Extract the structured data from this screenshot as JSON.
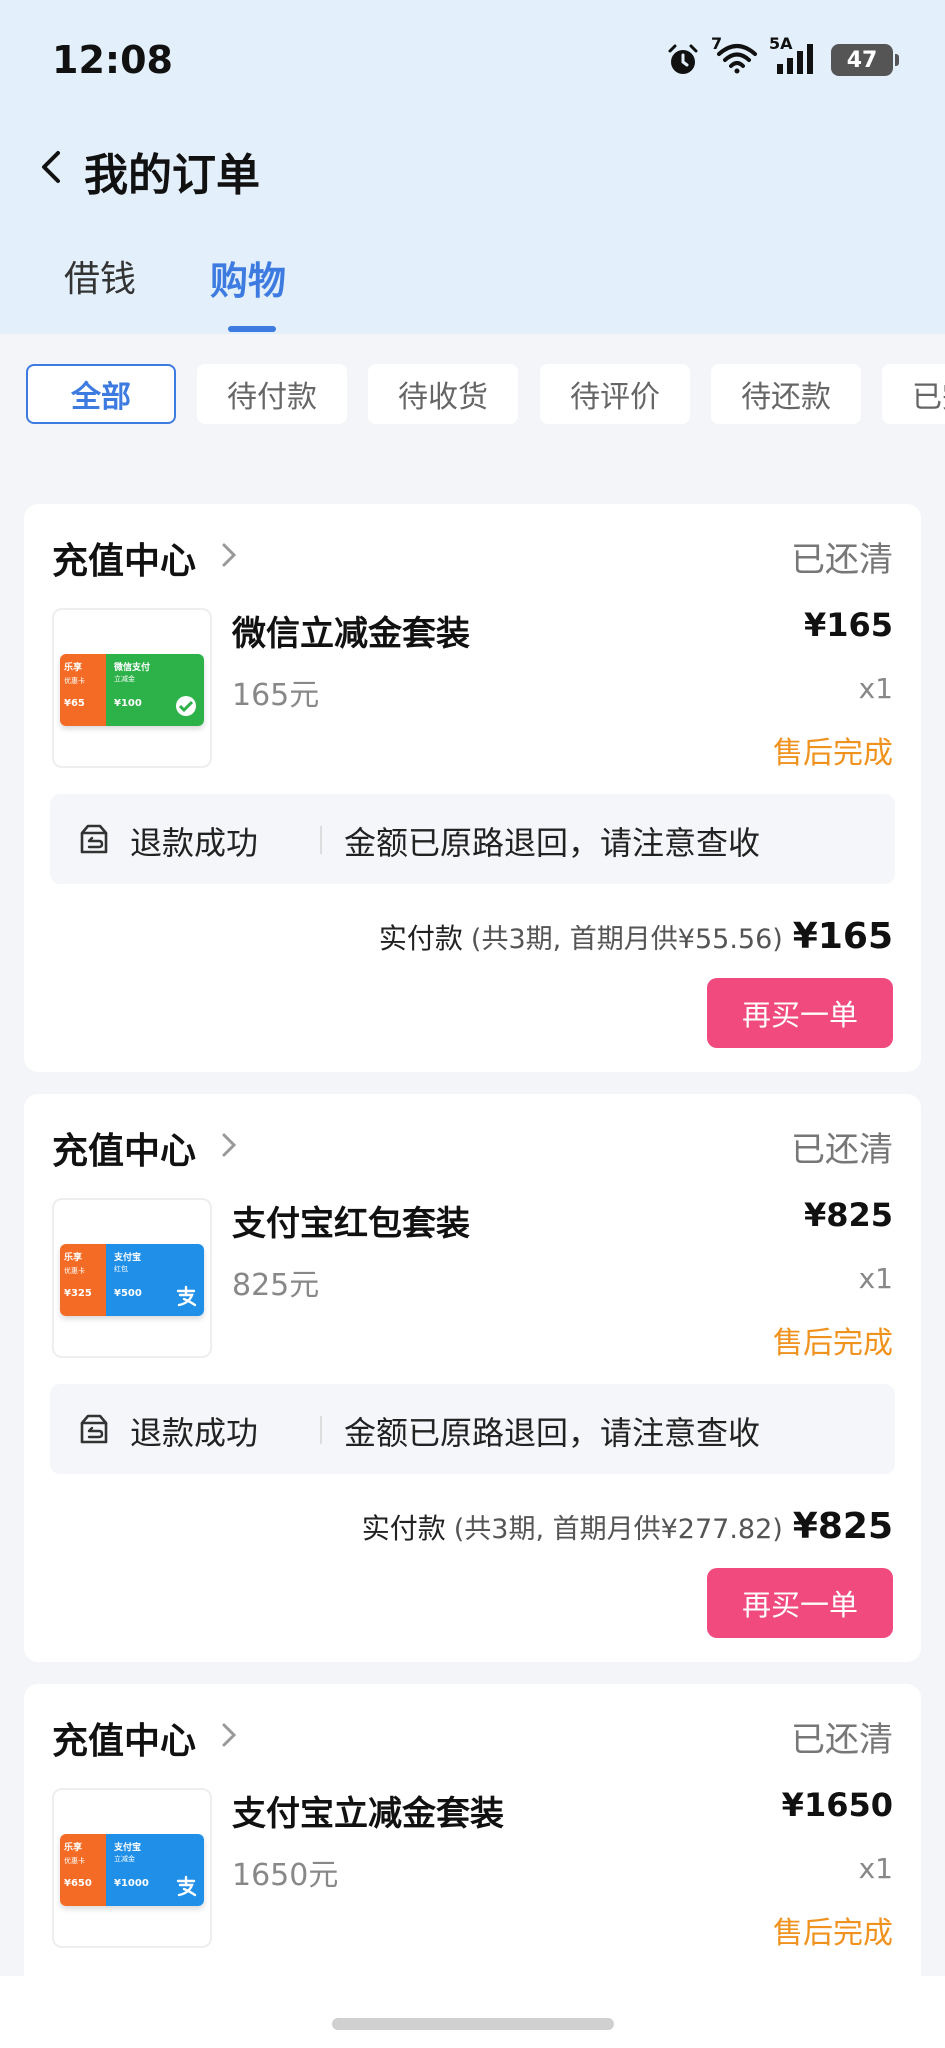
{
  "status_bar": {
    "time": "12:08",
    "wifi_label": "7",
    "signal_label": "5A",
    "battery": "47"
  },
  "header": {
    "title": "我的订单"
  },
  "tabs": [
    {
      "label": "借钱",
      "active": false
    },
    {
      "label": "购物",
      "active": true
    }
  ],
  "filters": [
    "全部",
    "待付款",
    "待收货",
    "待评价",
    "待还款",
    "已完成"
  ],
  "orders": [
    {
      "store": "充值中心",
      "status": "已还清",
      "product_name": "微信立减金套装",
      "product_spec": "165元",
      "price": "¥165",
      "qty": "x1",
      "after_sale": "售后完成",
      "refund_label": "退款成功",
      "refund_message": "金额已原路退回，请注意查收",
      "pay_label": "实付款",
      "pay_detail": "(共3期, 首期月供¥55.56)",
      "pay_total": "¥165",
      "rebuy": "再买一单",
      "thumb": {
        "brand": "乐享",
        "left_sub": "优惠卡",
        "left_value": "¥65",
        "right_title": "微信支付",
        "right_sub": "立减金",
        "right_value": "¥100",
        "color": "#2db24a",
        "icon": "wechat-pay-icon"
      }
    },
    {
      "store": "充值中心",
      "status": "已还清",
      "product_name": "支付宝红包套装",
      "product_spec": "825元",
      "price": "¥825",
      "qty": "x1",
      "after_sale": "售后完成",
      "refund_label": "退款成功",
      "refund_message": "金额已原路退回，请注意查收",
      "pay_label": "实付款",
      "pay_detail": "(共3期, 首期月供¥277.82)",
      "pay_total": "¥825",
      "rebuy": "再买一单",
      "thumb": {
        "brand": "乐享",
        "left_sub": "优惠卡",
        "left_value": "¥325",
        "right_title": "支付宝",
        "right_sub": "红包",
        "right_value": "¥500",
        "color": "#1f8fe8",
        "icon": "alipay-icon"
      }
    },
    {
      "store": "充值中心",
      "status": "已还清",
      "product_name": "支付宝立减金套装",
      "product_spec": "1650元",
      "price": "¥1650",
      "qty": "x1",
      "after_sale": "售后完成",
      "thumb": {
        "brand": "乐享",
        "left_sub": "优惠卡",
        "left_value": "¥650",
        "right_title": "支付宝",
        "right_sub": "立减金",
        "right_value": "¥1000",
        "color": "#1f8fe8",
        "icon": "alipay-icon"
      }
    }
  ],
  "colors": {
    "accent": "#3d7be0",
    "rebuy": "#f04a7e",
    "after_sale": "#f0921e",
    "header_bg": "#e3f0fb"
  }
}
